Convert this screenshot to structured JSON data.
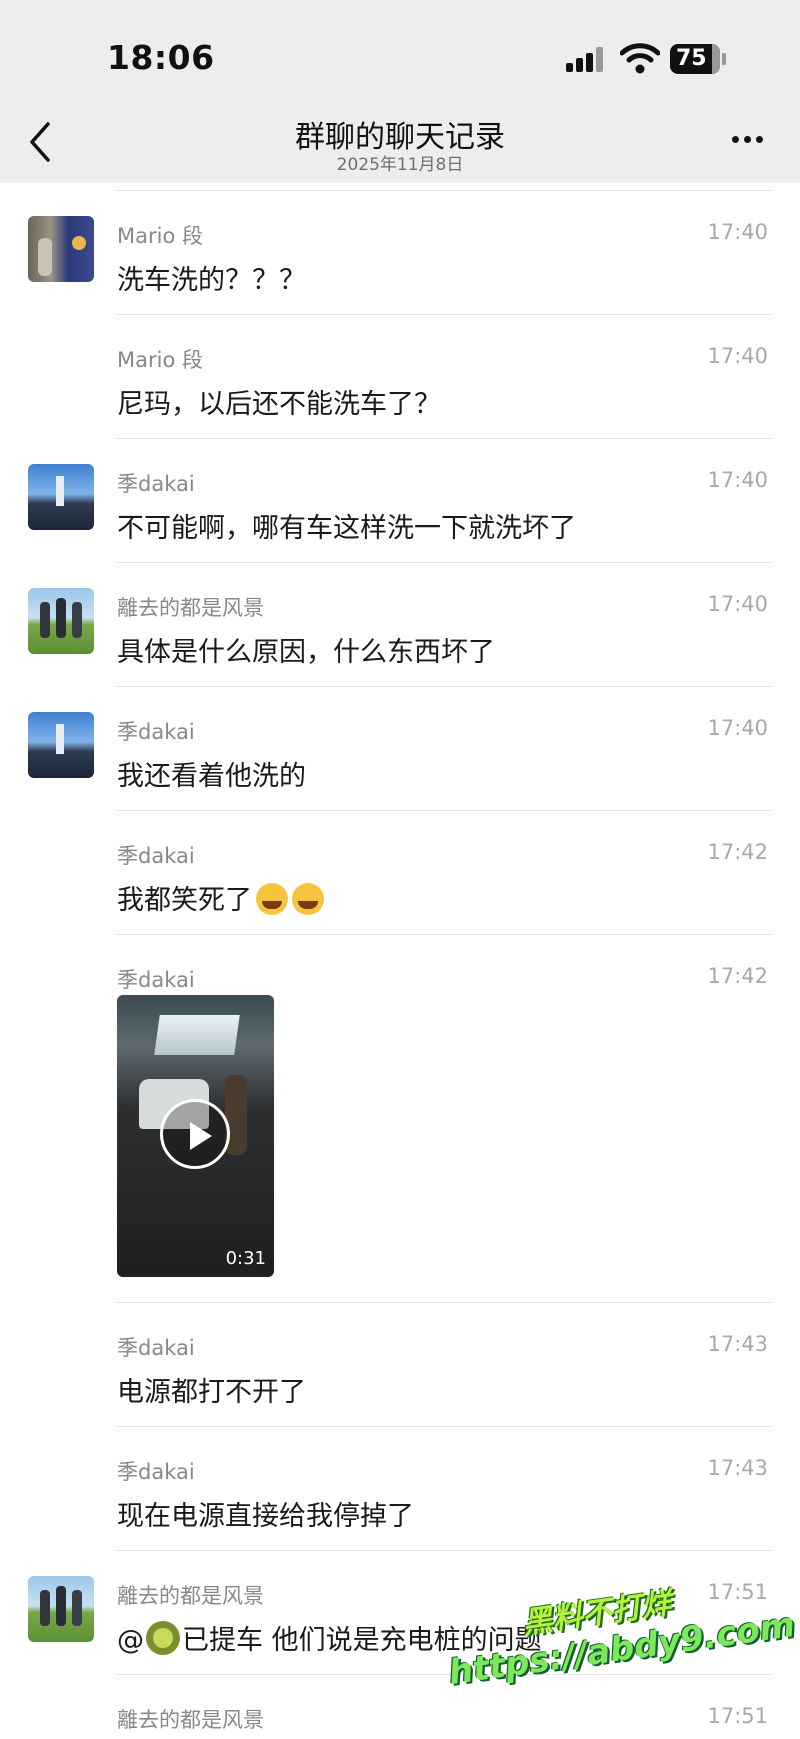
{
  "status_bar": {
    "time": "18:06",
    "battery": "75"
  },
  "header": {
    "title": "群聊的聊天记录",
    "date": "2025年11月8日"
  },
  "messages": [
    {
      "sender": "Mario 段",
      "time": "17:40",
      "text": "洗车洗的？？？"
    },
    {
      "sender": "Mario 段",
      "time": "17:40",
      "text": "尼玛，以后还不能洗车了？"
    },
    {
      "sender": "季dakai",
      "time": "17:40",
      "text": "不可能啊，哪有车这样洗一下就洗坏了"
    },
    {
      "sender": "離去的都是风景",
      "time": "17:40",
      "text": "具体是什么原因，什么东西坏了"
    },
    {
      "sender": "季dakai",
      "time": "17:40",
      "text": "我还看着他洗的"
    },
    {
      "sender": "季dakai",
      "time": "17:42",
      "text": "我都笑死了"
    },
    {
      "sender": "季dakai",
      "time": "17:42",
      "video_duration": "0:31"
    },
    {
      "sender": "季dakai",
      "time": "17:43",
      "text": "电源都打不开了"
    },
    {
      "sender": "季dakai",
      "time": "17:43",
      "text": "现在电源直接给我停掉了"
    },
    {
      "sender": "離去的都是风景",
      "time": "17:51",
      "text_prefix": "@",
      "text": "已提车 他们说是充电桩的问题"
    },
    {
      "sender": "離去的都是风景",
      "time": "17:51"
    }
  ],
  "icons": [
    "back-arrow-icon",
    "more-dots-icon",
    "signal-icon",
    "wifi-icon",
    "battery-icon",
    "play-icon",
    "laugh-cry-emoji-icon",
    "kiwi-emoji-icon"
  ],
  "watermark": {
    "line1": "黑料不打烊",
    "line2": "https://abdy9.com"
  }
}
